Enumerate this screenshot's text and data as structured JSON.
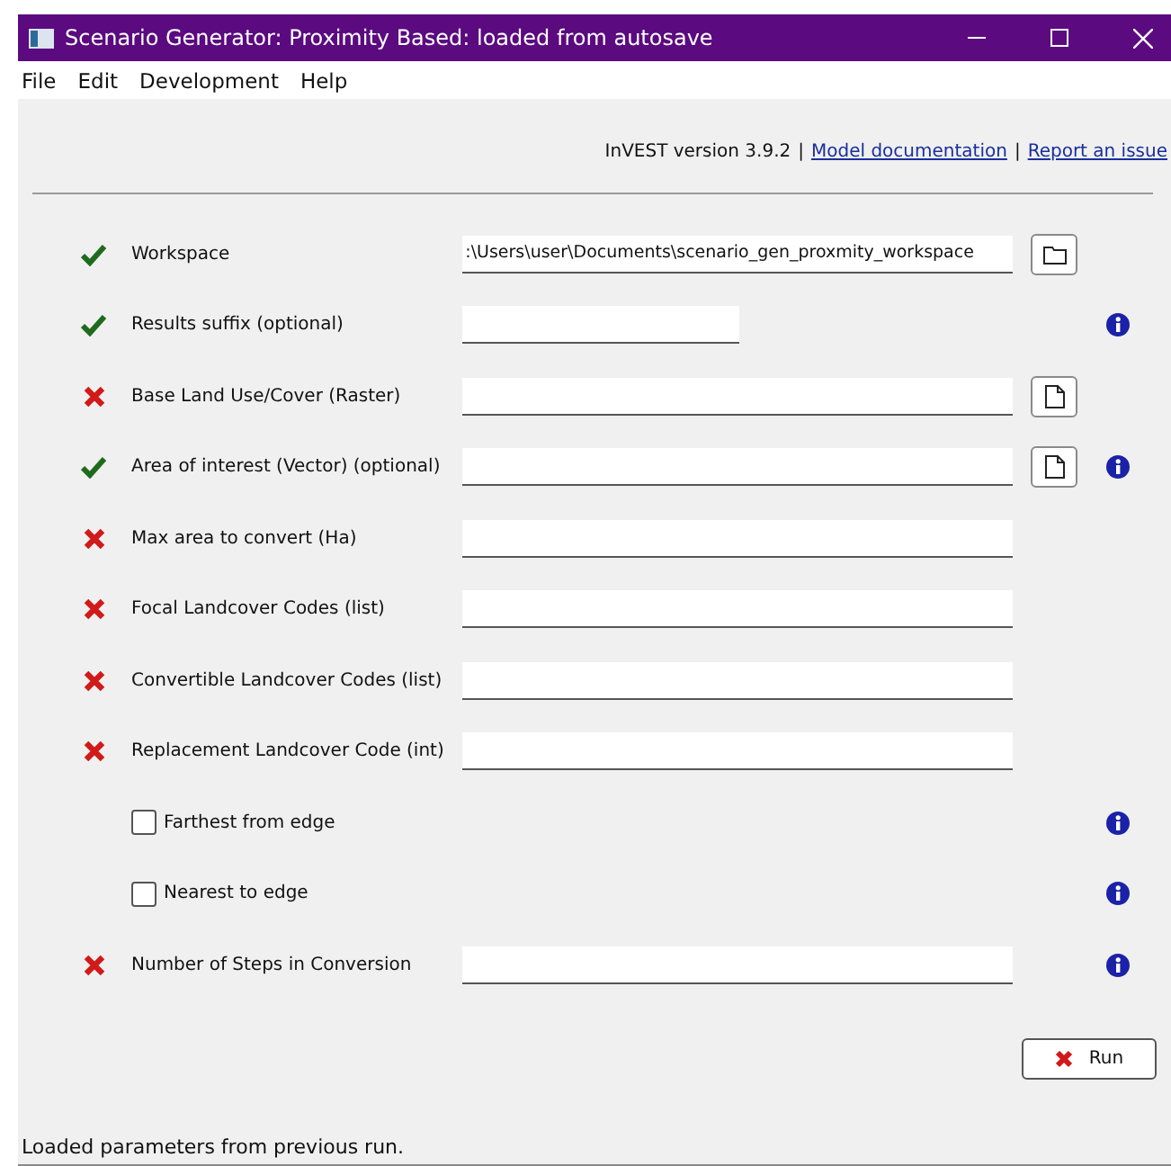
{
  "window": {
    "title": "Scenario Generator: Proximity Based: loaded from autosave"
  },
  "menu": [
    "File",
    "Edit",
    "Development",
    "Help"
  ],
  "header": [
    {
      "kind": "text",
      "text": "InVEST version 3.9.2"
    },
    {
      "kind": "separator",
      "text": "|"
    },
    {
      "kind": "link",
      "text": "Model documentation"
    },
    {
      "kind": "separator",
      "text": "|"
    },
    {
      "kind": "link",
      "text": "Report an issue"
    }
  ],
  "rows": [
    {
      "kind": "text",
      "label": "Workspace",
      "valid": true,
      "value": ":\\Users\\user\\Documents\\scenario_gen_proxmity_workspace",
      "compact": false,
      "button": {
        "kind": "folder"
      },
      "info": false
    },
    {
      "kind": "text",
      "label": "Results suffix (optional)",
      "valid": true,
      "compact": true,
      "info": true
    },
    {
      "kind": "text",
      "label": "Base Land Use/Cover (Raster)",
      "valid": false,
      "compact": false,
      "button": {
        "kind": "file"
      },
      "info": false
    },
    {
      "kind": "text",
      "label": "Area of interest (Vector) (optional)",
      "valid": true,
      "compact": false,
      "button": {
        "kind": "file"
      },
      "info": true
    },
    {
      "kind": "text",
      "label": "Max area to convert (Ha)",
      "valid": false,
      "compact": false,
      "info": false
    },
    {
      "kind": "text",
      "label": "Focal Landcover Codes (list)",
      "valid": false,
      "compact": false,
      "info": false
    },
    {
      "kind": "text",
      "label": "Convertible Landcover Codes (list)",
      "valid": false,
      "compact": false,
      "info": false
    },
    {
      "kind": "text",
      "label": "Replacement Landcover Code (int)",
      "valid": false,
      "compact": false,
      "info": false
    },
    {
      "kind": "checkbox",
      "label": "Farthest from edge",
      "checked": false,
      "info": true
    },
    {
      "kind": "checkbox",
      "label": "Nearest to edge",
      "checked": false,
      "info": true
    },
    {
      "kind": "text",
      "label": "Number of Steps in Conversion",
      "valid": false,
      "compact": false,
      "info": true
    }
  ],
  "run_button": {
    "label": "Run",
    "ready": false
  },
  "status_bar": "Loaded parameters from previous run."
}
